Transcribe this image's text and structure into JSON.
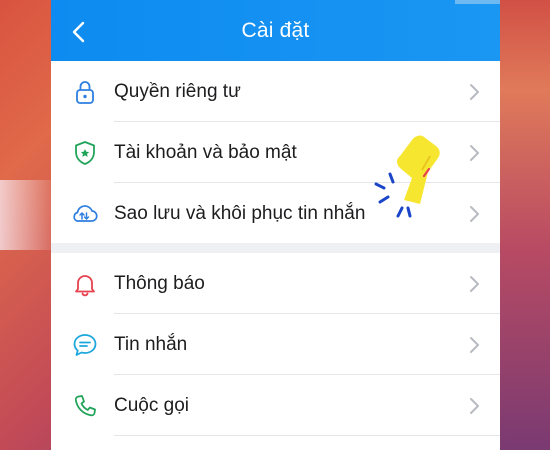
{
  "header": {
    "title": "Cài đặt"
  },
  "group1": {
    "items": [
      {
        "label": "Quyền riêng tư",
        "icon": "lock-icon"
      },
      {
        "label": "Tài khoản và bảo mật",
        "icon": "shield-star-icon"
      },
      {
        "label": "Sao lưu và khôi phục tin nhắn",
        "icon": "cloud-sync-icon"
      }
    ]
  },
  "group2": {
    "items": [
      {
        "label": "Thông báo",
        "icon": "bell-icon"
      },
      {
        "label": "Tin nhắn",
        "icon": "chat-bubble-icon"
      },
      {
        "label": "Cuộc gọi",
        "icon": "phone-icon"
      }
    ]
  },
  "colors": {
    "header": "#1a96f3",
    "icon_blue": "#2f7fe0",
    "icon_green": "#22a35a",
    "icon_red": "#e8424f",
    "icon_teal": "#1ea7dd",
    "hand": "#f7e630"
  }
}
